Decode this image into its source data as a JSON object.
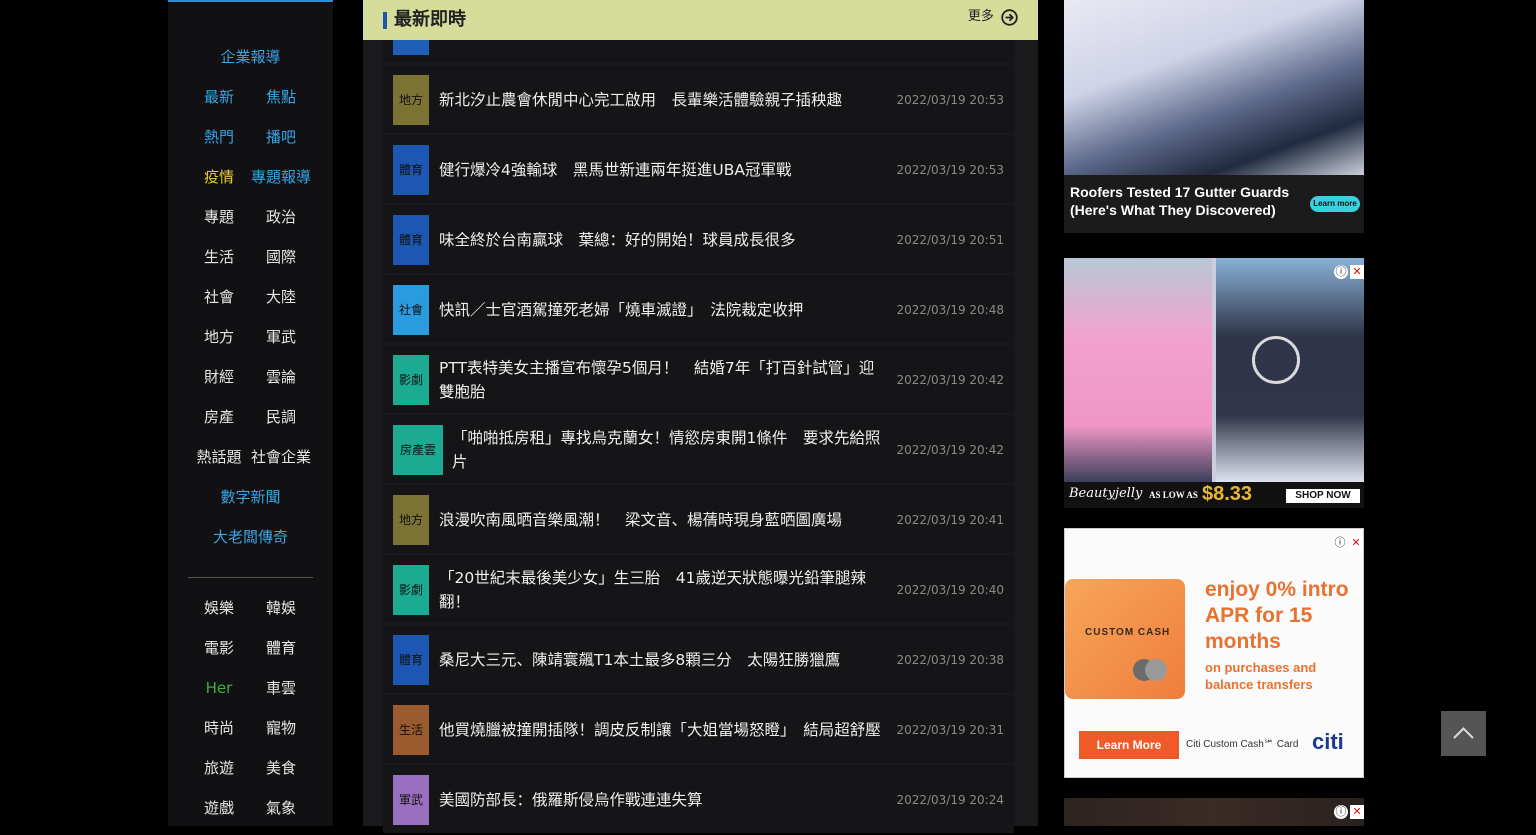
{
  "sidebar": {
    "rows": [
      {
        "single": {
          "label": "企業報導",
          "color": "blue"
        }
      },
      {
        "left": {
          "label": "最新",
          "color": "blue"
        },
        "right": {
          "label": "焦點",
          "color": "blue"
        }
      },
      {
        "left": {
          "label": "熱門",
          "color": "blue"
        },
        "right": {
          "label": "播吧",
          "color": "blue"
        }
      },
      {
        "left": {
          "label": "疫情",
          "color": "yellow"
        },
        "right": {
          "label": "專題報導",
          "color": "blue"
        }
      },
      {
        "left": {
          "label": "專題",
          "color": "white"
        },
        "right": {
          "label": "政治",
          "color": "white"
        }
      },
      {
        "left": {
          "label": "生活",
          "color": "white"
        },
        "right": {
          "label": "國際",
          "color": "white"
        }
      },
      {
        "left": {
          "label": "社會",
          "color": "white"
        },
        "right": {
          "label": "大陸",
          "color": "white"
        }
      },
      {
        "left": {
          "label": "地方",
          "color": "white"
        },
        "right": {
          "label": "軍武",
          "color": "white"
        }
      },
      {
        "left": {
          "label": "財經",
          "color": "white"
        },
        "right": {
          "label": "雲論",
          "color": "white"
        }
      },
      {
        "left": {
          "label": "房產",
          "color": "white"
        },
        "right": {
          "label": "民調",
          "color": "white"
        }
      },
      {
        "left": {
          "label": "熱話題",
          "color": "white"
        },
        "right": {
          "label": "社會企業",
          "color": "white"
        }
      },
      {
        "single": {
          "label": "數字新聞",
          "color": "blue"
        }
      },
      {
        "single": {
          "label": "大老闆傳奇",
          "color": "blue"
        }
      }
    ],
    "rows2": [
      {
        "left": {
          "label": "娛樂",
          "color": "white"
        },
        "right": {
          "label": "韓娛",
          "color": "white"
        }
      },
      {
        "left": {
          "label": "電影",
          "color": "white"
        },
        "right": {
          "label": "體育",
          "color": "white"
        }
      },
      {
        "left": {
          "label": "Her",
          "color": "green"
        },
        "right": {
          "label": "車雲",
          "color": "white"
        }
      },
      {
        "left": {
          "label": "時尚",
          "color": "white"
        },
        "right": {
          "label": "寵物",
          "color": "white"
        }
      },
      {
        "left": {
          "label": "旅遊",
          "color": "white"
        },
        "right": {
          "label": "美食",
          "color": "white"
        }
      },
      {
        "left": {
          "label": "遊戲",
          "color": "white"
        },
        "right": {
          "label": "氣象",
          "color": "white"
        }
      }
    ]
  },
  "news": {
    "title": "最新即時",
    "more_label": "更多",
    "items": [
      {
        "category": "地方",
        "cat_color": "#7b7233",
        "headline": "新北汐止農會休閒中心完工啟用　長輩樂活體驗親子插秧趣",
        "time": "2022/03/19 20:53"
      },
      {
        "category": "體育",
        "cat_color": "#1d57b3",
        "headline": "健行爆冷4強輸球　黑馬世新連兩年挺進UBA冠軍戰",
        "time": "2022/03/19 20:53"
      },
      {
        "category": "體育",
        "cat_color": "#1d57b3",
        "headline": "味全終於台南贏球　葉總：好的開始！球員成長很多",
        "time": "2022/03/19 20:51"
      },
      {
        "category": "社會",
        "cat_color": "#2b9be0",
        "headline": "快訊／士官酒駕撞死老婦「燒車滅證」　法院裁定收押",
        "time": "2022/03/19 20:48"
      },
      {
        "category": "影劇",
        "cat_color": "#1bab93",
        "headline": "PTT表特美女主播宣布懷孕5個月！　結婚7年「打百針試管」迎雙胞胎",
        "time": "2022/03/19 20:42"
      },
      {
        "category": "房產雲",
        "cat_color": "#1bab93",
        "headline": "「啪啪抵房租」專找烏克蘭女！情慾房東開1條件　要求先給照片",
        "time": "2022/03/19 20:42"
      },
      {
        "category": "地方",
        "cat_color": "#7b7233",
        "headline": "浪漫吹南風晒音樂風潮！　梁文音、楊蒨時現身藍晒圖廣場",
        "time": "2022/03/19 20:41"
      },
      {
        "category": "影劇",
        "cat_color": "#1bab93",
        "headline": "「20世紀末最後美少女」生三胎　41歲逆天狀態曝光鉛筆腿辣翻！",
        "time": "2022/03/19 20:40"
      },
      {
        "category": "體育",
        "cat_color": "#1d57b3",
        "headline": "桑尼大三元、陳靖寰飆T1本土最多8顆三分　太陽狂勝獵鷹",
        "time": "2022/03/19 20:38"
      },
      {
        "category": "生活",
        "cat_color": "#9a5b2e",
        "headline": "他買燒臘被撞開插隊！調皮反制讓「大姐當場怒瞪」　結局超舒壓",
        "time": "2022/03/19 20:31"
      },
      {
        "category": "軍武",
        "cat_color": "#9a6fc0",
        "headline": "美國防部長：俄羅斯侵烏作戰連連失算",
        "time": "2022/03/19 20:24"
      }
    ]
  },
  "ads": {
    "ad1": {
      "caption": "Roofers Tested 17 Gutter Guards (Here's What They Discovered)",
      "button": "Learn more"
    },
    "ad2": {
      "brand": "Beautyjelly",
      "as_low_as": "AS LOW AS",
      "price": "$8.33",
      "button": "SHOP NOW"
    },
    "ad3": {
      "card_label": "CUSTOM CASH",
      "headline": "enjoy 0% intro APR for 15 months",
      "sub": "on purchases and balance transfers",
      "button": "Learn More",
      "product": "Citi Custom Cash℠ Card",
      "brand": "citi"
    },
    "info_glyph": "ⓘ",
    "close_glyph": "✕"
  },
  "colors": {
    "accent_blue": "#35a5e6",
    "header_bg": "#d6dd9a"
  }
}
